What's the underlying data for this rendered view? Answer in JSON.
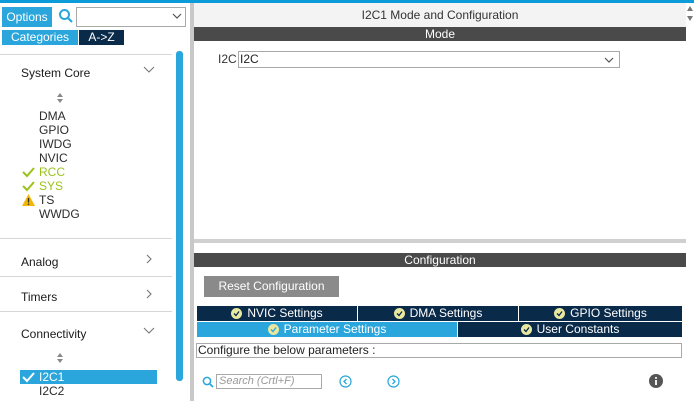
{
  "left": {
    "options_label": "Options",
    "search_value": "",
    "categories_label": "Categories",
    "az_label": "A->Z",
    "groups": {
      "system_core": "System Core",
      "analog": "Analog",
      "timers": "Timers",
      "connectivity": "Connectivity"
    },
    "system_core_items": [
      "DMA",
      "GPIO",
      "IWDG",
      "NVIC",
      "RCC",
      "SYS",
      "TS",
      "WWDG"
    ],
    "connectivity_items": [
      "I2C1",
      "I2C2"
    ]
  },
  "right": {
    "title": "I2C1 Mode and Configuration",
    "mode_header": "Mode",
    "i2c_label": "I2C",
    "i2c_value": "I2C",
    "config_header": "Configuration",
    "reset_button": "Reset Configuration",
    "tabs": {
      "nvic": "NVIC Settings",
      "dma": "DMA Settings",
      "gpio": "GPIO Settings",
      "parameter": "Parameter Settings",
      "user_constants": "User Constants"
    },
    "configure_text": "Configure the below parameters :",
    "search_placeholder": "Search (Crtl+F)"
  },
  "colors": {
    "accent": "#2aa6dc",
    "dark_tab": "#0a2a4a",
    "ok_green": "#9ac21a",
    "warning": "#f2b705",
    "header_bar": "#4a4a4a"
  }
}
